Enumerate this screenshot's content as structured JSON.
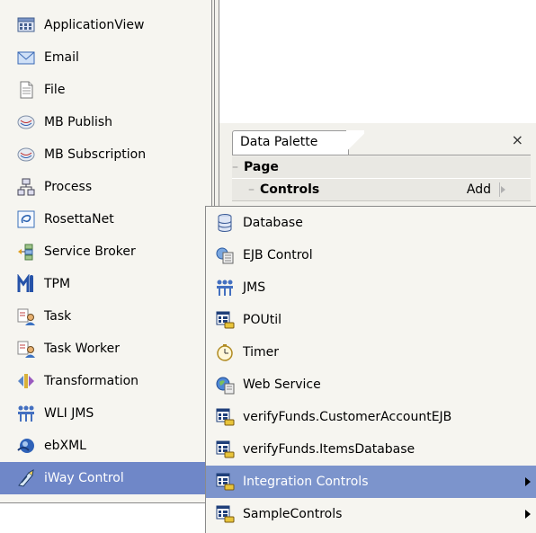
{
  "left_menu": {
    "items": [
      {
        "label": "ApplicationView",
        "icon": "application-view-icon"
      },
      {
        "label": "Email",
        "icon": "email-icon"
      },
      {
        "label": "File",
        "icon": "file-icon"
      },
      {
        "label": "MB Publish",
        "icon": "mb-publish-icon"
      },
      {
        "label": "MB Subscription",
        "icon": "mb-subscription-icon"
      },
      {
        "label": "Process",
        "icon": "process-icon"
      },
      {
        "label": "RosettaNet",
        "icon": "rosettanet-icon"
      },
      {
        "label": "Service Broker",
        "icon": "service-broker-icon"
      },
      {
        "label": "TPM",
        "icon": "tpm-icon"
      },
      {
        "label": "Task",
        "icon": "task-icon"
      },
      {
        "label": "Task Worker",
        "icon": "task-worker-icon"
      },
      {
        "label": "Transformation",
        "icon": "transformation-icon"
      },
      {
        "label": "WLI JMS",
        "icon": "wli-jms-icon"
      },
      {
        "label": "ebXML",
        "icon": "ebxml-icon"
      },
      {
        "label": "iWay Control",
        "icon": "iway-control-icon",
        "selected": true
      }
    ]
  },
  "palette": {
    "tab_label": "Data Palette",
    "close_glyph": "×",
    "tree": {
      "page_label": "Page",
      "controls_label": "Controls",
      "add_label": "Add"
    }
  },
  "right_menu": {
    "items": [
      {
        "label": "Database",
        "icon": "database-icon"
      },
      {
        "label": "EJB Control",
        "icon": "ejb-control-icon"
      },
      {
        "label": "JMS",
        "icon": "jms-icon"
      },
      {
        "label": "POUtil",
        "icon": "control-icon"
      },
      {
        "label": "Timer",
        "icon": "timer-icon"
      },
      {
        "label": "Web Service",
        "icon": "web-service-icon"
      },
      {
        "label": "verifyFunds.CustomerAccountEJB",
        "icon": "control-icon"
      },
      {
        "label": "verifyFunds.ItemsDatabase",
        "icon": "control-icon"
      },
      {
        "label": "Integration Controls",
        "icon": "control-icon",
        "selected": true,
        "submenu": true
      },
      {
        "label": "SampleControls",
        "icon": "control-icon",
        "submenu": true
      }
    ]
  },
  "colors": {
    "menu_bg": "#f6f5f0",
    "selection": "#7c94cc",
    "border": "#8a8a8a"
  }
}
